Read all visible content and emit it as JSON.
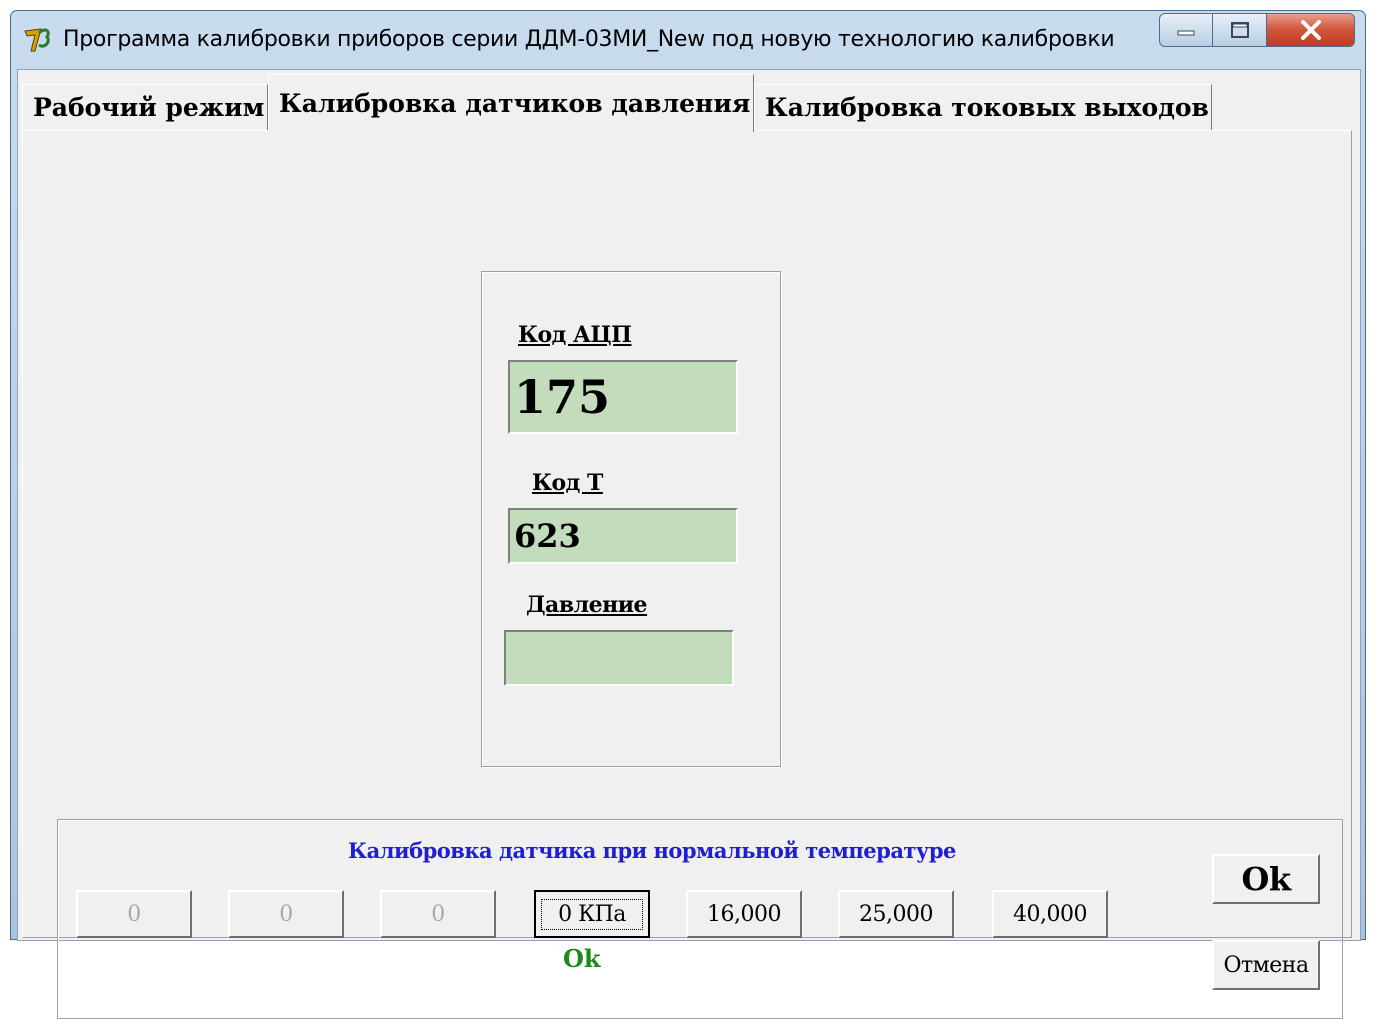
{
  "window": {
    "title": "Программа калибровки приборов серии ДДМ-03МИ_New под новую технологию калибровки",
    "icon": "app-logo-icon",
    "controls": [
      "minimize-icon",
      "maximize-icon",
      "close-icon"
    ]
  },
  "tabs": [
    {
      "label": "Рабочий режим",
      "active": false
    },
    {
      "label": "Калибровка датчиков давления",
      "active": true
    },
    {
      "label": "Калибровка токовых выходов",
      "active": false
    }
  ],
  "readings": {
    "adc_label": "Код АЦП",
    "adc_value": "175",
    "t_label": "Код Т",
    "t_value": "623",
    "pressure_label": "Давление",
    "pressure_value": ""
  },
  "calibration": {
    "title": "Калибровка датчика при нормальной температуре",
    "buttons": [
      {
        "label": "0",
        "enabled": false
      },
      {
        "label": "0",
        "enabled": false
      },
      {
        "label": "0",
        "enabled": false
      },
      {
        "label": "0 КПа",
        "enabled": true,
        "focused": true
      },
      {
        "label": "16,000",
        "enabled": true
      },
      {
        "label": "25,000",
        "enabled": true
      },
      {
        "label": "40,000",
        "enabled": true
      }
    ],
    "status": "Ok",
    "ok_label": "Ok",
    "cancel_label": "Отмена"
  },
  "colors": {
    "field_bg": "#c2dcbc",
    "calib_title": "#1f1fd0",
    "status_ok": "#1a8a1a"
  }
}
